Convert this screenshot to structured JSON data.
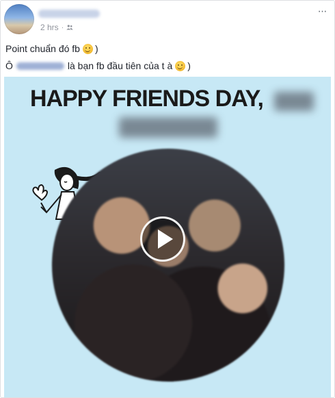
{
  "post": {
    "timestamp": "2 hrs",
    "separator": "·",
    "privacy_icon": "friends-icon",
    "more_icon": "more-options-icon",
    "more_label": "···",
    "message": {
      "line1_text": "Point chuẩn đó fb",
      "line1_close": ")",
      "line2_prefix": "Ô",
      "line2_text": "là bạn fb đầu tiên của t à",
      "line2_close": ")",
      "emoji": "smiley-emoji-icon"
    }
  },
  "media": {
    "headline": "HAPPY FRIENDS DAY,",
    "background_color": "#c7e8f5",
    "play_icon": "play-icon"
  }
}
